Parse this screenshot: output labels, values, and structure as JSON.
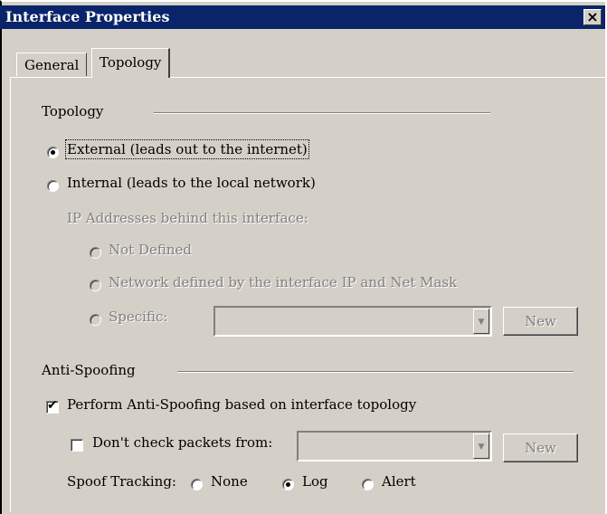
{
  "window": {
    "title": "Interface Properties",
    "close_label": "×"
  },
  "tabs": [
    {
      "label": "General",
      "selected": false
    },
    {
      "label": "Topology",
      "selected": true
    }
  ],
  "topology": {
    "group_label": "Topology",
    "external_label": "External (leads out to the internet)",
    "internal_label": "Internal (leads to the local network)",
    "ip_behind_label": "IP Addresses behind this interface:",
    "not_defined_label": "Not Defined",
    "network_defined_label": "Network defined by the interface IP and Net Mask",
    "specific_label": "Specific:",
    "specific_value": "",
    "new_button": "New"
  },
  "anti_spoofing": {
    "group_label": "Anti-Spoofing",
    "perform_label": "Perform Anti-Spoofing based on interface topology",
    "dont_check_label": "Don't check packets from:",
    "dont_check_value": "",
    "new_button": "New",
    "spoof_tracking_label": "Spoof Tracking:",
    "tracking_options": [
      "None",
      "Log",
      "Alert"
    ],
    "selected_tracking": "Log"
  }
}
